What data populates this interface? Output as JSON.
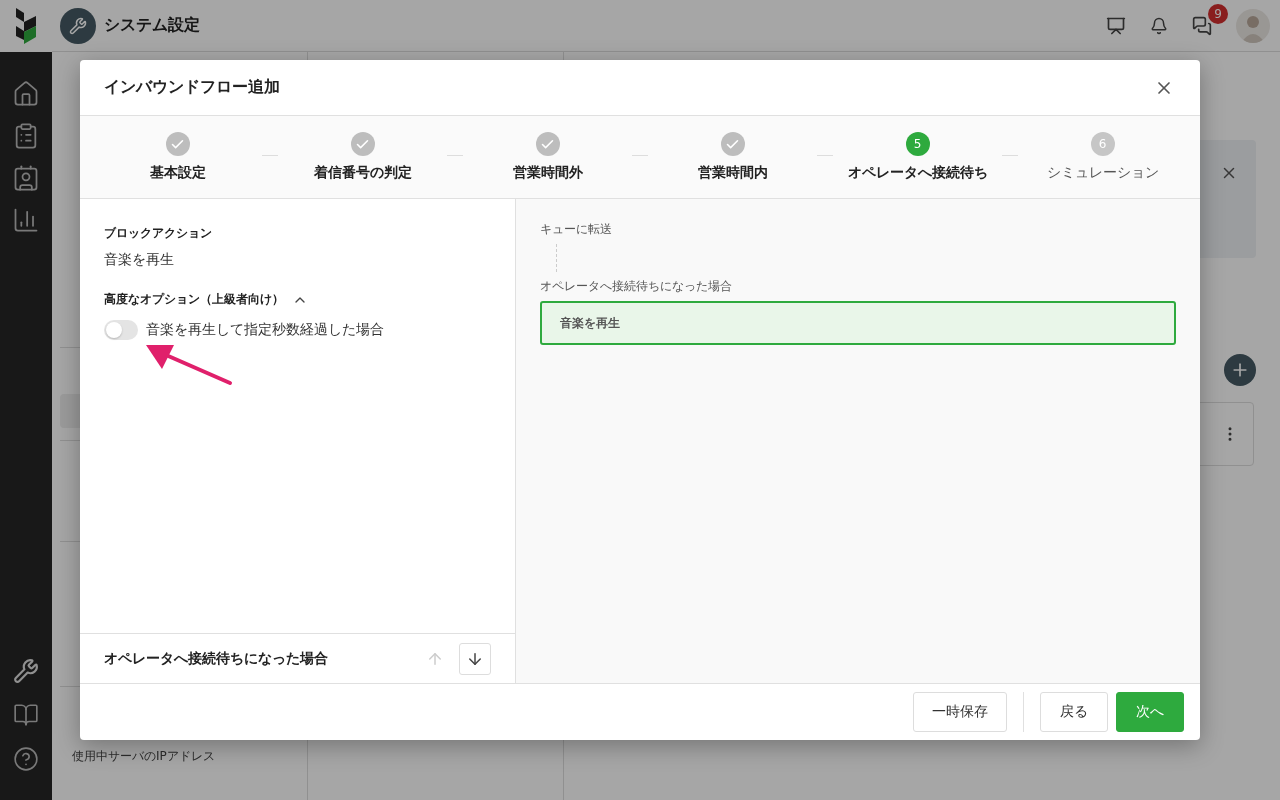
{
  "app": {
    "title": "システム設定",
    "chat_badge": "9"
  },
  "settings_menu": {
    "items": [
      {
        "label": "使用中サーバのIPアドレス"
      }
    ]
  },
  "dialog": {
    "title": "インバウンドフロー追加",
    "steps": [
      {
        "label": "基本設定",
        "completed": true,
        "selected": false
      },
      {
        "label": "着信番号の判定",
        "completed": true,
        "selected": false
      },
      {
        "label": "営業時間外",
        "completed": true,
        "selected": false
      },
      {
        "label": "営業時間内",
        "completed": true,
        "selected": false
      },
      {
        "label": "オペレータへ接続待ち",
        "completed": false,
        "selected": true,
        "number": "5"
      },
      {
        "label": "シミュレーション",
        "completed": false,
        "selected": false,
        "number": "6"
      }
    ],
    "block_action_label": "ブロックアクション",
    "block_action_value": "音楽を再生",
    "advanced": {
      "label": "高度なオプション（上級者向け）",
      "expanded": true,
      "options": [
        {
          "label": "音楽を再生して指定秒数経過した場合",
          "on": false
        }
      ]
    },
    "section_footer": {
      "title": "オペレータへ接続待ちになった場合",
      "up_disabled": true,
      "down_disabled": false
    },
    "flow": {
      "start": "キューに転送",
      "branch": "オペレータへ接続待ちになった場合",
      "blocks": [
        {
          "label": "音楽を再生",
          "selected": true
        }
      ]
    },
    "buttons_left": [
      {
        "label": "一時保存",
        "primary": false
      }
    ],
    "buttons_right": [
      {
        "label": "戻る",
        "primary": false
      },
      {
        "label": "次へ",
        "primary": true
      }
    ]
  }
}
